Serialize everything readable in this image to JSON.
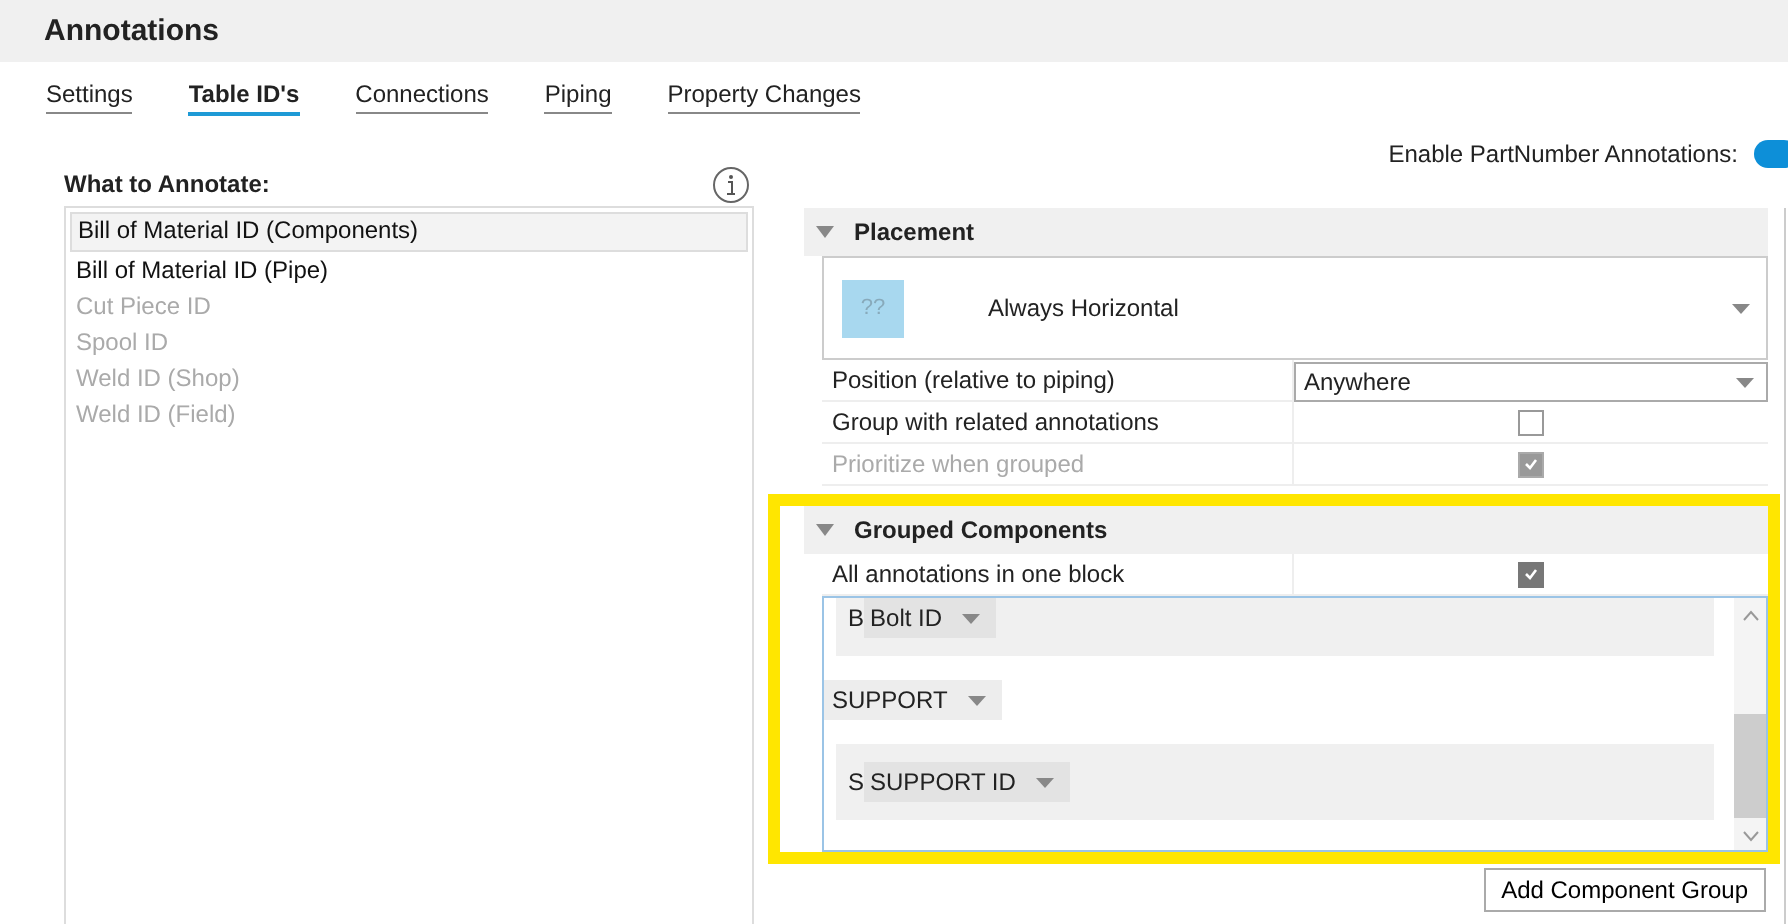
{
  "window": {
    "title": "Annotations"
  },
  "tabs": [
    {
      "label": "Settings",
      "selected": false
    },
    {
      "label": "Table ID's",
      "selected": true
    },
    {
      "label": "Connections",
      "selected": false
    },
    {
      "label": "Piping",
      "selected": false
    },
    {
      "label": "Property Changes",
      "selected": false
    }
  ],
  "annotate": {
    "label": "What to Annotate:",
    "items": [
      {
        "label": "Bill of Material ID (Components)",
        "selected": true,
        "disabled": false
      },
      {
        "label": "Bill of Material ID (Pipe)",
        "selected": false,
        "disabled": false
      },
      {
        "label": "Cut Piece ID",
        "selected": false,
        "disabled": true
      },
      {
        "label": "Spool ID",
        "selected": false,
        "disabled": true
      },
      {
        "label": "Weld ID (Shop)",
        "selected": false,
        "disabled": true
      },
      {
        "label": "Weld ID (Field)",
        "selected": false,
        "disabled": true
      }
    ]
  },
  "enable_toggle": {
    "label": "Enable PartNumber Annotations:",
    "on": true
  },
  "placement": {
    "title": "Placement",
    "expanded": true,
    "style_icon_text": "??",
    "style_value": "Always Horizontal",
    "rows": [
      {
        "kind": "dropdown",
        "label": "Position (relative to piping)",
        "value": "Anywhere"
      },
      {
        "kind": "checkbox",
        "label": "Group with related annotations",
        "checked": false
      },
      {
        "kind": "checkbox",
        "label": "Prioritize when grouped",
        "checked": true,
        "disabled": true
      }
    ]
  },
  "grouped_components": {
    "title": "Grouped Components",
    "expanded": true,
    "highlighted": true,
    "rows": [
      {
        "kind": "checkbox",
        "label": "All annotations in one block",
        "checked": true
      }
    ],
    "list": [
      {
        "kind": "entry",
        "prefix": "B",
        "value": "Bolt ID"
      },
      {
        "kind": "group",
        "value": "SUPPORT"
      },
      {
        "kind": "entry",
        "prefix": "S",
        "value": "SUPPORT ID"
      }
    ]
  },
  "add_button": "Add Component Group"
}
